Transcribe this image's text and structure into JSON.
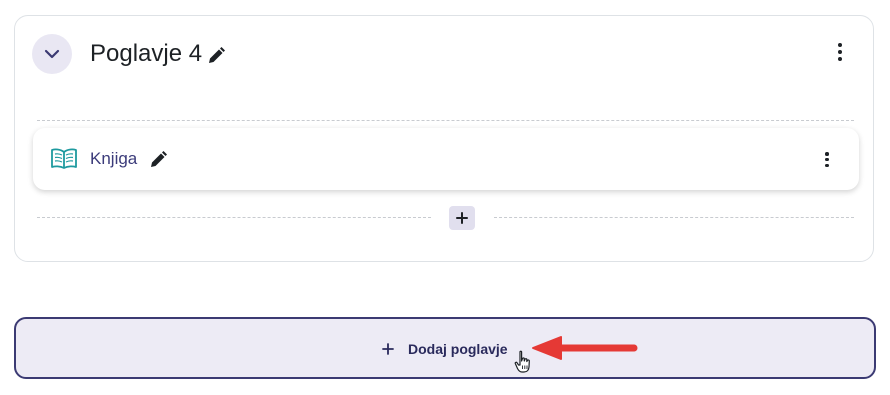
{
  "section": {
    "title": "Poglavje 4",
    "activity": {
      "name": "Knjiga"
    }
  },
  "add_section": {
    "label": "Dodaj poglavje"
  },
  "colors": {
    "accent": "#3b3a73",
    "book_icon": "#1e9a9f",
    "annotation_arrow": "#e53935"
  }
}
